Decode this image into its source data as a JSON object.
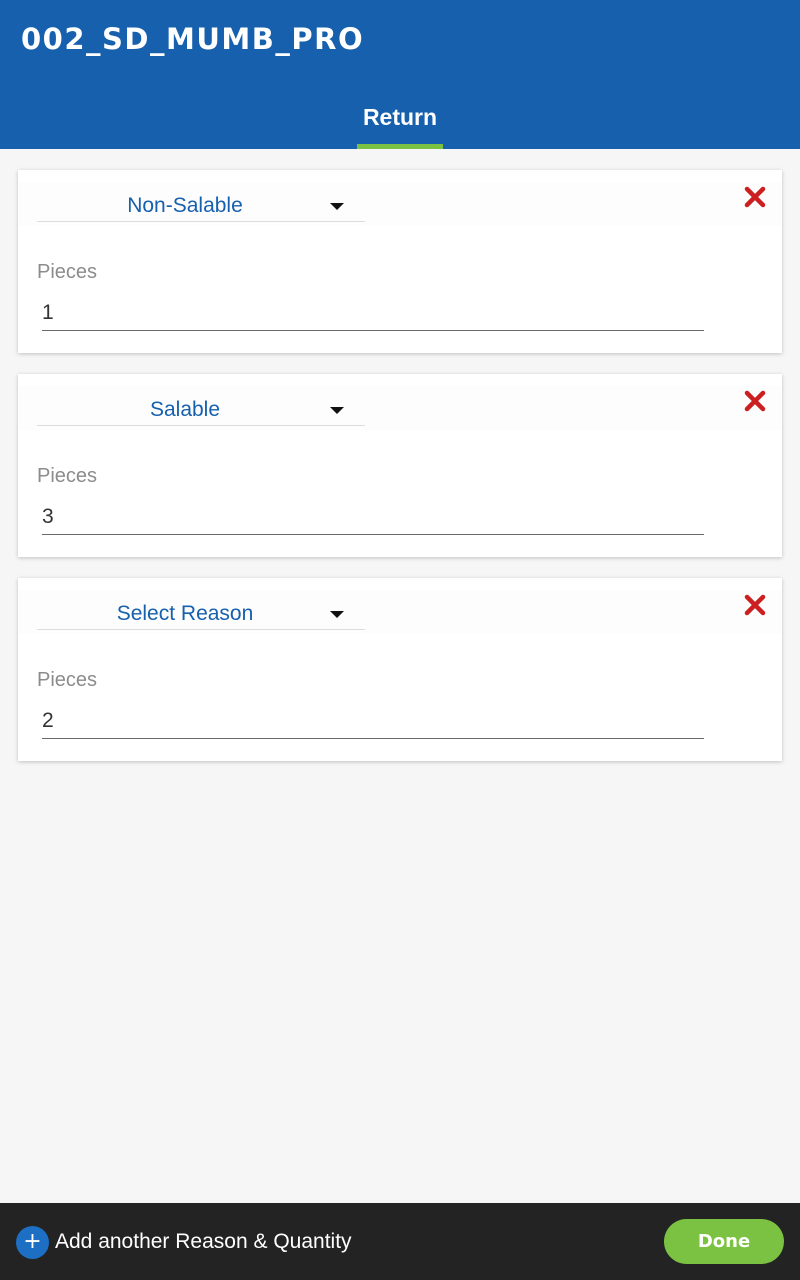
{
  "header": {
    "title": "002_SD_MUMB_PRO",
    "active_tab": "Return"
  },
  "entries": [
    {
      "reason": "Non-Salable",
      "pieces_label": "Pieces",
      "pieces": "1"
    },
    {
      "reason": "Salable",
      "pieces_label": "Pieces",
      "pieces": "3"
    },
    {
      "reason": "Select Reason",
      "pieces_label": "Pieces",
      "pieces": "2"
    }
  ],
  "footer": {
    "add_label": "Add another Reason & Quantity",
    "done_label": "Done"
  },
  "colors": {
    "primary": "#1660ad",
    "accent_green": "#7cc242",
    "remove_red": "#cc1f1f",
    "footer_bg": "#232323"
  },
  "icons": {
    "remove": "close-icon",
    "dropdown": "caret-down-icon",
    "add": "plus-icon"
  }
}
